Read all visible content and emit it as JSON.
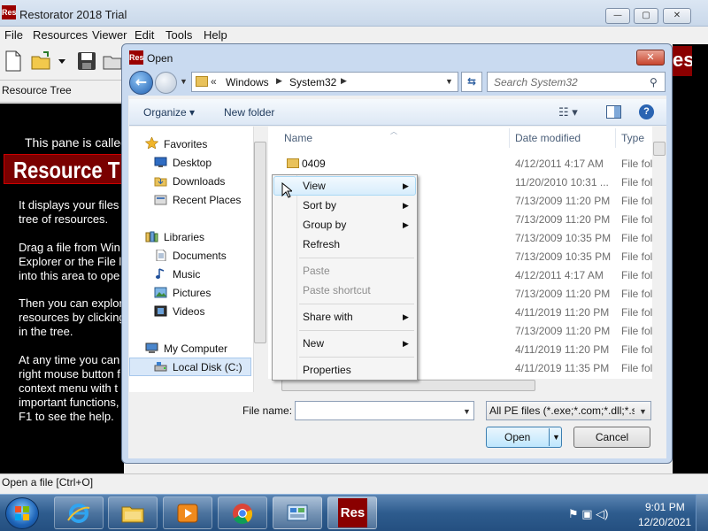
{
  "main_window": {
    "title": "Restorator 2018 Trial",
    "app_icon_text": "Res",
    "caption_buttons": {
      "minimize": "—",
      "maximize": "▢",
      "close": "✕"
    },
    "menu": [
      "File",
      "Resources",
      "Viewer",
      "Edit",
      "Tools",
      "Help"
    ],
    "resource_tree_label": "Resource Tree",
    "left_pane": {
      "called": "This pane is called",
      "banner": "Resource T",
      "lines": [
        "It displays your files",
        "tree of resources.",
        "",
        "Drag a file from Win",
        "Explorer or the File l",
        "into this area to ope",
        "",
        "Then you can explor",
        "resources by clicking",
        "in the tree.",
        "",
        "At any time you can",
        "right mouse button f",
        "context menu with t",
        "important functions,",
        "F1 to see the help."
      ]
    },
    "right_logo_text": "es",
    "status_text": "Open a file [Ctrl+O]"
  },
  "dialog": {
    "title": "Open",
    "app_icon_text": "Res",
    "close": "✕",
    "address": {
      "chevrons": "«",
      "segments": [
        "Windows",
        "System32"
      ],
      "separator": "▶"
    },
    "search_placeholder": "Search System32",
    "commands": {
      "organize": "Organize ▾",
      "new_folder": "New folder",
      "views": "☷ ▾",
      "help": "?"
    },
    "nav": {
      "favorites": "Favorites",
      "favorites_items": [
        "Desktop",
        "Downloads",
        "Recent Places"
      ],
      "libraries": "Libraries",
      "libraries_items": [
        "Documents",
        "Music",
        "Pictures",
        "Videos"
      ],
      "computer": "My Computer",
      "computer_items": [
        "Local Disk (C:)"
      ]
    },
    "columns": {
      "name": "Name",
      "date": "Date modified",
      "type": "Type"
    },
    "files": [
      {
        "name": "0409",
        "date": "4/12/2011 4:17 AM",
        "type": "File fol"
      },
      {
        "name": "",
        "date": "11/20/2010 10:31 ...",
        "type": "File fol"
      },
      {
        "name": "",
        "date": "7/13/2009 11:20 PM",
        "type": "File fol"
      },
      {
        "name": "",
        "date": "7/13/2009 11:20 PM",
        "type": "File fol"
      },
      {
        "name": "",
        "date": "7/13/2009 10:35 PM",
        "type": "File fol"
      },
      {
        "name": "",
        "date": "7/13/2009 10:35 PM",
        "type": "File fol"
      },
      {
        "name": "",
        "date": "4/12/2011 4:17 AM",
        "type": "File fol"
      },
      {
        "name": "",
        "date": "7/13/2009 11:20 PM",
        "type": "File fol"
      },
      {
        "name": "",
        "date": "4/11/2019 11:20 PM",
        "type": "File fol"
      },
      {
        "name": "",
        "date": "7/13/2009 11:20 PM",
        "type": "File fol"
      },
      {
        "name": "",
        "date": "4/11/2019 11:20 PM",
        "type": "File fol"
      },
      {
        "name": "",
        "date": "4/11/2019 11:35 PM",
        "type": "File fol"
      }
    ],
    "filename_label": "File name:",
    "filename_value": "",
    "filter": "All PE files (*.exe;*.com;*.dll;*.scr)",
    "open_label": "Open",
    "cancel_label": "Cancel"
  },
  "context_menu": {
    "items": [
      {
        "label": "View",
        "submenu": true,
        "disabled": false
      },
      {
        "label": "Sort by",
        "submenu": true,
        "disabled": false
      },
      {
        "label": "Group by",
        "submenu": true,
        "disabled": false
      },
      {
        "label": "Refresh",
        "submenu": false,
        "disabled": false
      },
      {
        "label": "Paste",
        "submenu": false,
        "disabled": true
      },
      {
        "label": "Paste shortcut",
        "submenu": false,
        "disabled": true
      },
      {
        "label": "Share with",
        "submenu": true,
        "disabled": false
      },
      {
        "label": "New",
        "submenu": true,
        "disabled": false
      },
      {
        "label": "Properties",
        "submenu": false,
        "disabled": false
      }
    ],
    "arrow": "▶"
  },
  "taskbar": {
    "pinned": [
      "internet-explorer-icon",
      "file-explorer-icon",
      "media-player-icon",
      "chrome-icon",
      "control-panel-icon",
      "restorator-icon"
    ],
    "restorator_text": "Res",
    "tray_icons": "⚑ ▣ ◁)",
    "time": "9:01 PM",
    "date": "12/20/2021"
  },
  "colors": {
    "taskbar": "#2e5c8e",
    "dialog_frame": "#c9daf0",
    "close_red": "#c8462e",
    "pane_black": "#000000",
    "banner_red": "#7a0000"
  }
}
